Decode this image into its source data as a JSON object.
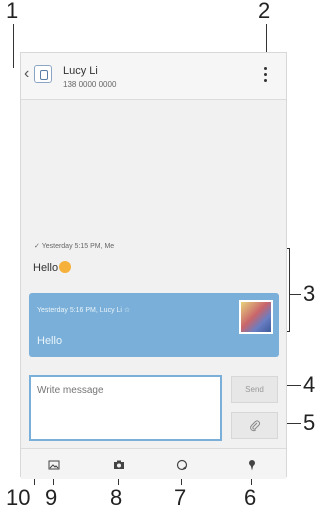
{
  "callouts": [
    "1",
    "2",
    "3",
    "4",
    "5",
    "6",
    "7",
    "8",
    "9",
    "10"
  ],
  "contact": {
    "name": "Lucy Li",
    "number": "138 0000 0000"
  },
  "messages": {
    "outgoing": {
      "meta": "Yesterday 5:15 PM, Me",
      "text": "Hello"
    },
    "incoming": {
      "meta": "Yesterday 5:16 PM, Lucy Li",
      "text": "Hello"
    }
  },
  "compose": {
    "placeholder": "Write message",
    "send_label": "Send"
  },
  "colors": {
    "accent": "#79afd8"
  },
  "icons": {
    "back": "back-arrow-icon",
    "menu": "overflow-menu-icon",
    "attach": "paperclip-icon",
    "image": "image-icon",
    "camera": "camera-icon",
    "sticker": "sticker-icon",
    "location": "location-pin-icon"
  }
}
